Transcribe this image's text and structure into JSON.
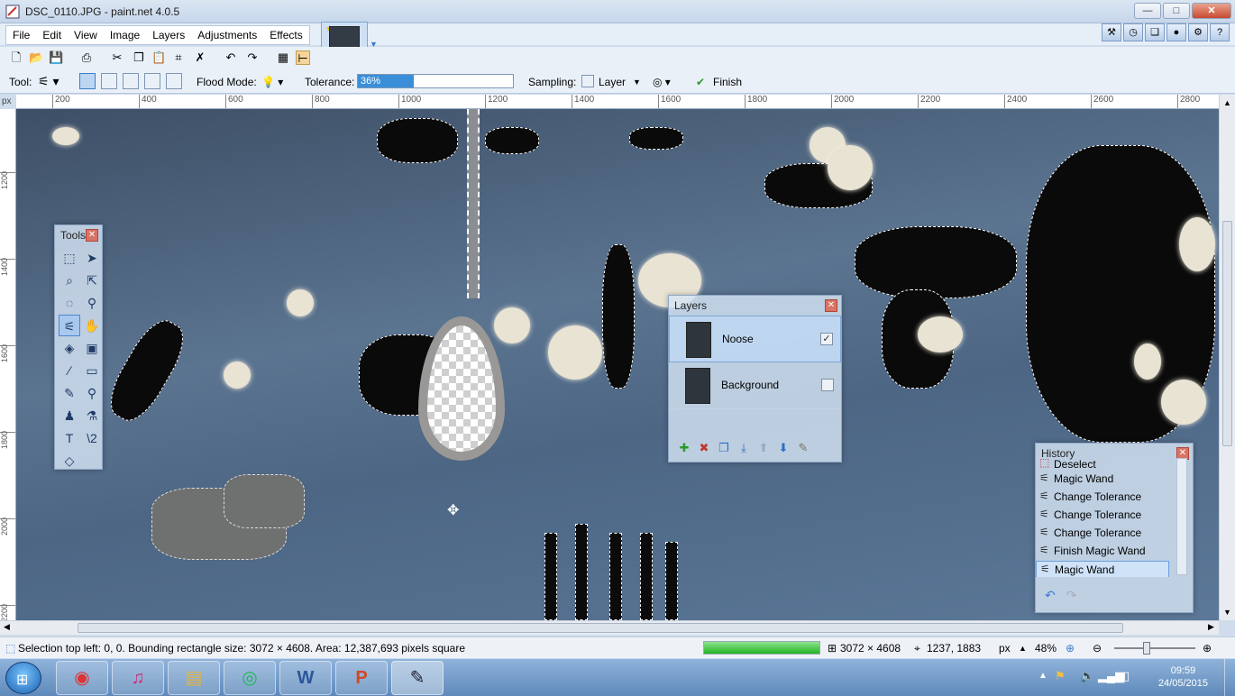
{
  "window": {
    "title": "DSC_0110.JPG - paint.net 4.0.5",
    "buttons": {
      "minimize": "—",
      "maximize": "□",
      "close": "✕"
    }
  },
  "menu": {
    "items": [
      "File",
      "Edit",
      "View",
      "Image",
      "Layers",
      "Adjustments",
      "Effects"
    ]
  },
  "toolbar2": {
    "tool_label": "Tool:",
    "flood_mode_label": "Flood Mode:",
    "tolerance_label": "Tolerance:",
    "tolerance_value": "36%",
    "tolerance_fraction": 0.36,
    "sampling_label": "Sampling:",
    "sampling_value": "Layer",
    "finish_label": "Finish"
  },
  "ruler": {
    "unit": "px",
    "h_ticks": [
      "200",
      "400",
      "600",
      "800",
      "1000",
      "1200",
      "1400",
      "1600",
      "1800",
      "2000",
      "2200",
      "2400",
      "2600",
      "2800"
    ],
    "v_ticks": [
      "1200",
      "1400",
      "1600",
      "1800",
      "2000",
      "2200"
    ]
  },
  "tools_window": {
    "title": "Tools",
    "tools": [
      {
        "name": "rectangle-select",
        "glyph": "⬚"
      },
      {
        "name": "move-selected",
        "glyph": "➤"
      },
      {
        "name": "lasso-select",
        "glyph": "⌕"
      },
      {
        "name": "move-selection",
        "glyph": "⇱"
      },
      {
        "name": "ellipse-select",
        "glyph": "◌"
      },
      {
        "name": "zoom",
        "glyph": "🔍"
      },
      {
        "name": "magic-wand",
        "glyph": "⚟"
      },
      {
        "name": "pan",
        "glyph": "✋"
      },
      {
        "name": "paint-bucket",
        "glyph": "◈"
      },
      {
        "name": "gradient",
        "glyph": "▣"
      },
      {
        "name": "paintbrush",
        "glyph": "∕"
      },
      {
        "name": "eraser",
        "glyph": "▭"
      },
      {
        "name": "pencil",
        "glyph": "✎"
      },
      {
        "name": "color-picker",
        "glyph": "⚲"
      },
      {
        "name": "clone-stamp",
        "glyph": "♟"
      },
      {
        "name": "recolor",
        "glyph": "⚗"
      },
      {
        "name": "text",
        "glyph": "T"
      },
      {
        "name": "line-curve",
        "glyph": "\\2"
      },
      {
        "name": "shapes",
        "glyph": "◇"
      }
    ]
  },
  "layers_window": {
    "title": "Layers",
    "layers": [
      {
        "name": "Noose",
        "visible": "✓"
      },
      {
        "name": "Background",
        "visible": ""
      }
    ],
    "buttons": [
      {
        "name": "add-layer",
        "glyph": "✚"
      },
      {
        "name": "delete-layer",
        "glyph": "✖"
      },
      {
        "name": "duplicate-layer",
        "glyph": "❐"
      },
      {
        "name": "merge-layer-down",
        "glyph": "⤓"
      },
      {
        "name": "move-layer-up",
        "glyph": "⬆"
      },
      {
        "name": "move-layer-down",
        "glyph": "⬇"
      },
      {
        "name": "layer-properties",
        "glyph": "✎"
      }
    ]
  },
  "history_window": {
    "title": "History",
    "items": [
      "Deselect",
      "Magic Wand",
      "Change Tolerance",
      "Change Tolerance",
      "Change Tolerance",
      "Finish Magic Wand",
      "Magic Wand"
    ],
    "undo": "↶",
    "redo": "↷"
  },
  "status": {
    "selection_text": "Selection top left: 0, 0. Bounding rectangle size: 3072 × 4608. Area: 12,387,693 pixels square",
    "image_size": "3072 × 4608",
    "cursor_pos": "1237, 1883",
    "unit": "px",
    "zoom": "48%",
    "progress_fraction": 1.0
  },
  "taskbar": {
    "apps": [
      {
        "name": "chrome",
        "glyph": "◉"
      },
      {
        "name": "itunes",
        "glyph": "♫"
      },
      {
        "name": "explorer",
        "glyph": "▤"
      },
      {
        "name": "spotify",
        "glyph": "◎"
      },
      {
        "name": "word",
        "glyph": "W"
      },
      {
        "name": "powerpoint",
        "glyph": "P"
      },
      {
        "name": "paintnet",
        "glyph": "✎"
      }
    ],
    "time": "09:59",
    "date": "24/05/2015"
  },
  "colors": {
    "accent": "#3b8fd9",
    "selection": "#ffffff"
  }
}
